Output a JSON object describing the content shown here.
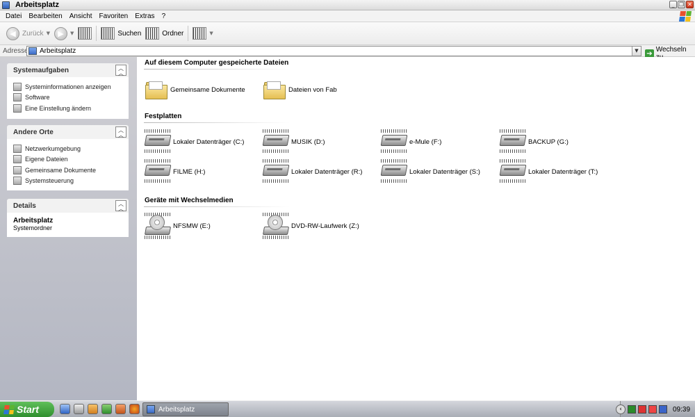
{
  "window": {
    "title": "Arbeitsplatz"
  },
  "menu": [
    "Datei",
    "Bearbeiten",
    "Ansicht",
    "Favoriten",
    "Extras",
    "?"
  ],
  "toolbar": {
    "back": "Zurück",
    "search": "Suchen",
    "folders": "Ordner"
  },
  "address": {
    "label": "Adresse",
    "value": "Arbeitsplatz",
    "go": "Wechseln zu"
  },
  "tasks": {
    "system": {
      "title": "Systemaufgaben",
      "items": [
        "Systeminformationen anzeigen",
        "Software",
        "Eine Einstellung ändern"
      ]
    },
    "other": {
      "title": "Andere Orte",
      "items": [
        "Netzwerkumgebung",
        "Eigene Dateien",
        "Gemeinsame Dokumente",
        "Systemsteuerung"
      ]
    },
    "details": {
      "title": "Details",
      "name": "Arbeitsplatz",
      "type": "Systemordner"
    }
  },
  "sections": {
    "files": {
      "title": "Auf diesem Computer gespeicherte Dateien",
      "items": [
        "Gemeinsame Dokumente",
        "Dateien von Fab"
      ]
    },
    "drives": {
      "title": "Festplatten",
      "items": [
        "Lokaler Datenträger (C:)",
        "MUSIK (D:)",
        "e-Mule (F:)",
        "BACKUP (G:)",
        "FILME (H:)",
        "Lokaler Datenträger (R:)",
        "Lokaler Datenträger (S:)",
        "Lokaler Datenträger (T:)"
      ]
    },
    "removable": {
      "title": "Geräte mit Wechselmedien",
      "items": [
        "NFSMW (E:)",
        "DVD-RW-Laufwerk (Z:)"
      ]
    }
  },
  "taskbar": {
    "start": "Start",
    "window_button": "Arbeitsplatz",
    "clock": "09:39"
  },
  "colors": {
    "xp_red": "#e8502e",
    "xp_green": "#5cb431",
    "xp_blue": "#2a75d6",
    "xp_yellow": "#f4c21a"
  }
}
